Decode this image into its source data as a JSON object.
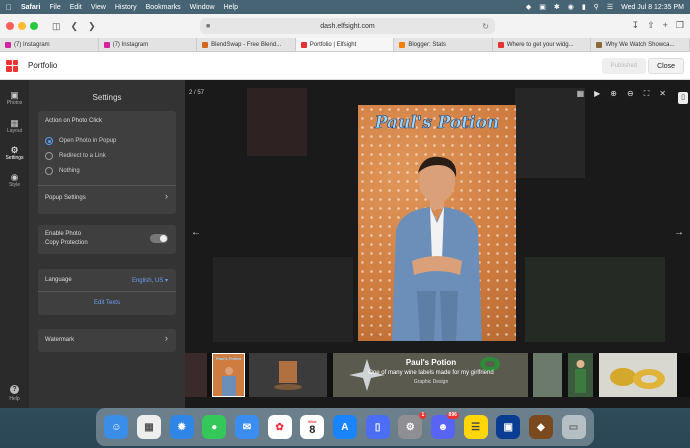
{
  "menubar": {
    "app": "Safari",
    "items": [
      "File",
      "Edit",
      "View",
      "History",
      "Bookmarks",
      "Window",
      "Help"
    ],
    "datetime": "Wed Jul 8  12:35 PM"
  },
  "browser": {
    "url": "dash.elfsight.com",
    "tabs": [
      {
        "label": "(7) Instagram",
        "color": "#d6249f"
      },
      {
        "label": "(7) Instagram",
        "color": "#d6249f"
      },
      {
        "label": "BlendSwap - Free Blend...",
        "color": "#d2691e"
      },
      {
        "label": "Portfolio | Elfsight",
        "color": "#e33333"
      },
      {
        "label": "Blogger: Stats",
        "color": "#f57d00"
      },
      {
        "label": "Where to get your widg...",
        "color": "#e33333"
      },
      {
        "label": "Why We Watch Showca...",
        "color": "#8b6b3a"
      }
    ]
  },
  "app": {
    "title": "Portfolio",
    "publish_label": "Published",
    "close_label": "Close"
  },
  "rail": {
    "photos": "Photos",
    "layout": "Layout",
    "settings": "Settings",
    "style": "Style",
    "help": "Help"
  },
  "settings": {
    "title": "Settings",
    "action_heading": "Action on Photo Click",
    "options": [
      "Open Photo in Popup",
      "Redirect to a Link",
      "Nothing"
    ],
    "popup_settings": "Popup Settings",
    "copy_protection_line1": "Enable Photo",
    "copy_protection_line2": "Copy Protection",
    "language_label": "Language",
    "language_value": "English, US",
    "edit_texts": "Edit Texts",
    "watermark": "Watermark"
  },
  "preview": {
    "counter": "2 / 57",
    "poster_title": "Paul's Potion",
    "caption_title": "Paul's Potion",
    "caption_desc": "One of many wine labels made for my girlfriend",
    "caption_category": "Graphic Design",
    "thumb_poster_title": "Paul's Potion"
  },
  "dock": {
    "mail_badge": "1",
    "discord_badge": "896",
    "calendar_month": "Wed",
    "calendar_day": "8"
  }
}
